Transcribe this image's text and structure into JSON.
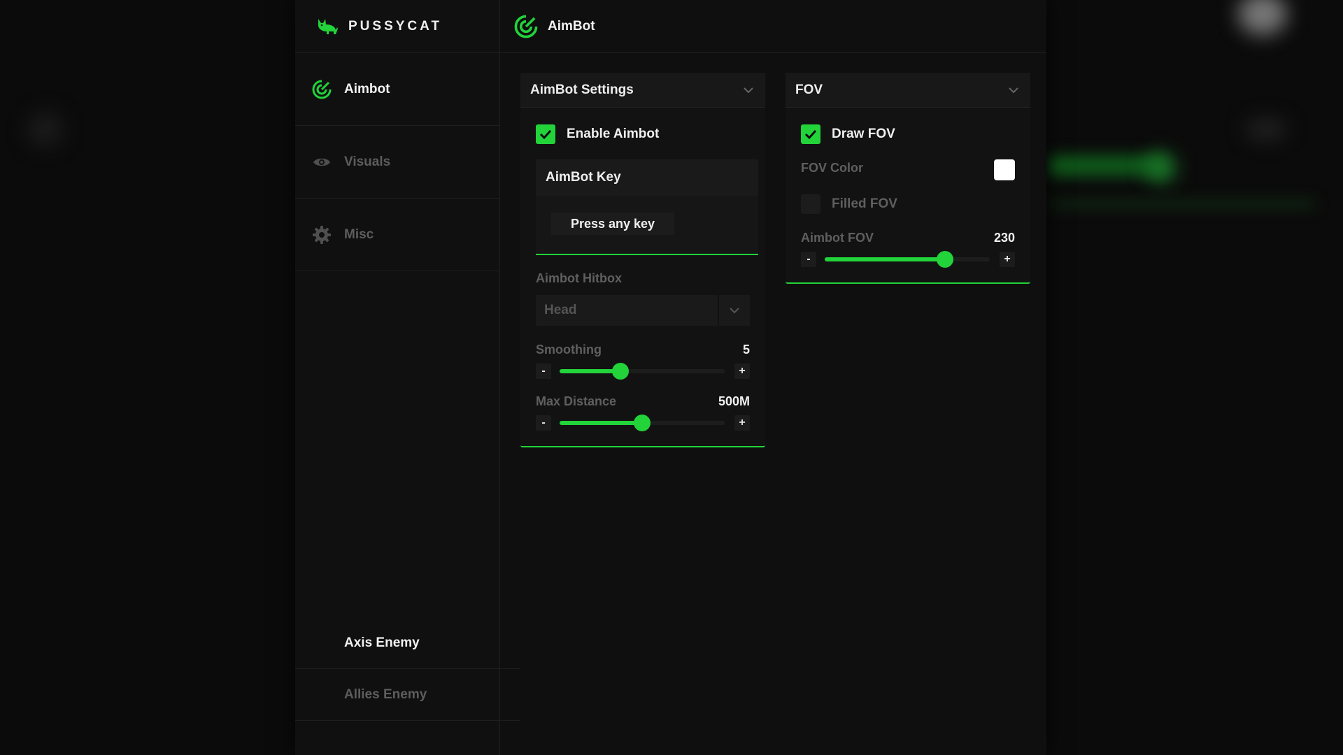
{
  "brand": {
    "name": "PUSSYCAT",
    "accent": "#22d33a"
  },
  "sidebar": {
    "items": [
      {
        "label": "Aimbot",
        "icon": "target-icon",
        "active": true
      },
      {
        "label": "Visuals",
        "icon": "eye-icon",
        "active": false
      },
      {
        "label": "Misc",
        "icon": "gear-icon",
        "active": false
      }
    ],
    "sub_items": [
      {
        "label": "Axis Enemy",
        "active": true
      },
      {
        "label": "Allies Enemy",
        "active": false
      }
    ]
  },
  "topbar": {
    "title": "AimBot",
    "icon": "target-icon"
  },
  "aimbot_panel": {
    "title": "AimBot Settings",
    "enable": {
      "label": "Enable Aimbot",
      "checked": true
    },
    "key": {
      "title": "AimBot Key",
      "button": "Press any key"
    },
    "hitbox": {
      "label": "Aimbot Hitbox",
      "value": "Head"
    },
    "smoothing": {
      "label": "Smoothing",
      "display": "5",
      "fraction": 0.37
    },
    "max_distance": {
      "label": "Max Distance",
      "display": "500M",
      "fraction": 0.5
    },
    "minus": "-",
    "plus": "+"
  },
  "fov_panel": {
    "title": "FOV",
    "draw": {
      "label": "Draw FOV",
      "checked": true
    },
    "color": {
      "label": "FOV Color",
      "value": "#ffffff"
    },
    "filled": {
      "label": "Filled FOV",
      "checked": false
    },
    "aimbot_fov": {
      "label": "Aimbot FOV",
      "display": "230",
      "fraction": 0.73
    },
    "minus": "-",
    "plus": "+"
  }
}
